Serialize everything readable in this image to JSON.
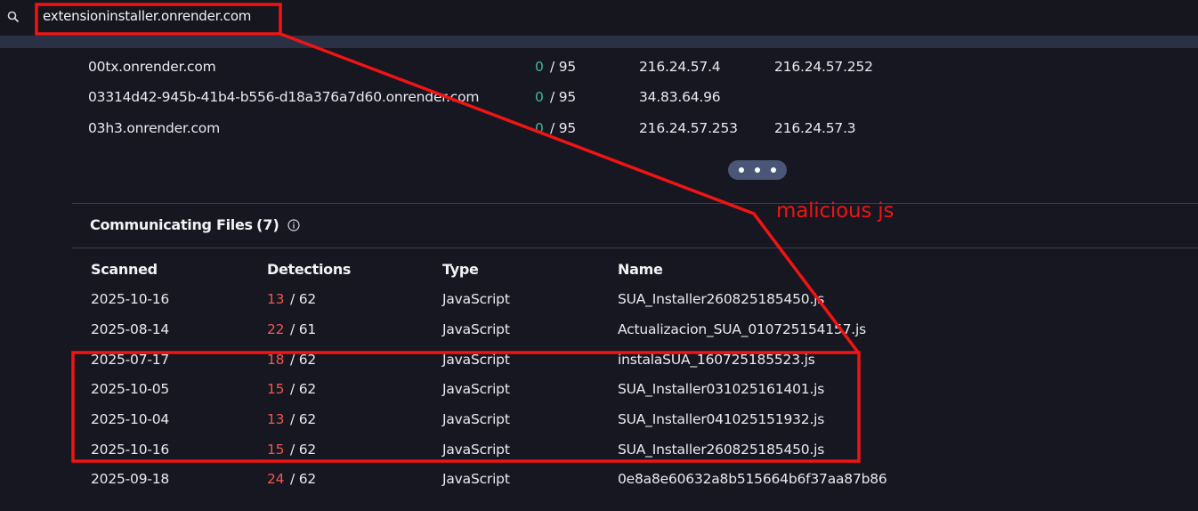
{
  "search": {
    "query": "extensioninstaller.onrender.com"
  },
  "subdomains": [
    {
      "name": "00tx.onrender.com",
      "detections": "0",
      "total": "/ 95",
      "ip1": "216.24.57.4",
      "ip2": "216.24.57.252"
    },
    {
      "name": "03314d42-945b-41b4-b556-d18a376a7d60.onrender.com",
      "detections": "0",
      "total": "/ 95",
      "ip1": "34.83.64.96",
      "ip2": ""
    },
    {
      "name": "03h3.onrender.com",
      "detections": "0",
      "total": "/ 95",
      "ip1": "216.24.57.253",
      "ip2": "216.24.57.3"
    }
  ],
  "communicating_files": {
    "title": "Communicating Files",
    "count": "(7)",
    "headers": [
      "Scanned",
      "Detections",
      "Type",
      "Name"
    ],
    "rows": [
      {
        "scanned": "2025-10-16",
        "detections": "13",
        "total": "/ 62",
        "type": "JavaScript",
        "name": "SUA_Installer260825185450.js"
      },
      {
        "scanned": "2025-08-14",
        "detections": "22",
        "total": "/ 61",
        "type": "JavaScript",
        "name": "Actualizacion_SUA_010725154157.js"
      },
      {
        "scanned": "2025-07-17",
        "detections": "18",
        "total": "/ 62",
        "type": "JavaScript",
        "name": "instalaSUA_160725185523.js"
      },
      {
        "scanned": "2025-10-05",
        "detections": "15",
        "total": "/ 62",
        "type": "JavaScript",
        "name": "SUA_Installer031025161401.js"
      },
      {
        "scanned": "2025-10-04",
        "detections": "13",
        "total": "/ 62",
        "type": "JavaScript",
        "name": "SUA_Installer041025151932.js"
      },
      {
        "scanned": "2025-10-16",
        "detections": "15",
        "total": "/ 62",
        "type": "JavaScript",
        "name": "SUA_Installer260825185450.js"
      },
      {
        "scanned": "2025-09-18",
        "detections": "24",
        "total": "/ 62",
        "type": "JavaScript",
        "name": "0e8a8e60632a8b515664b6f37aa87b86"
      }
    ]
  },
  "annotation": {
    "label": "malicious js",
    "color": "#f01414"
  },
  "colors": {
    "background": "#161721",
    "clean_detection": "#3fb99b",
    "malicious_detection": "#f0574f",
    "pill": "#4a5677"
  },
  "icons": [
    "search-icon",
    "more-icon",
    "info-icon"
  ]
}
